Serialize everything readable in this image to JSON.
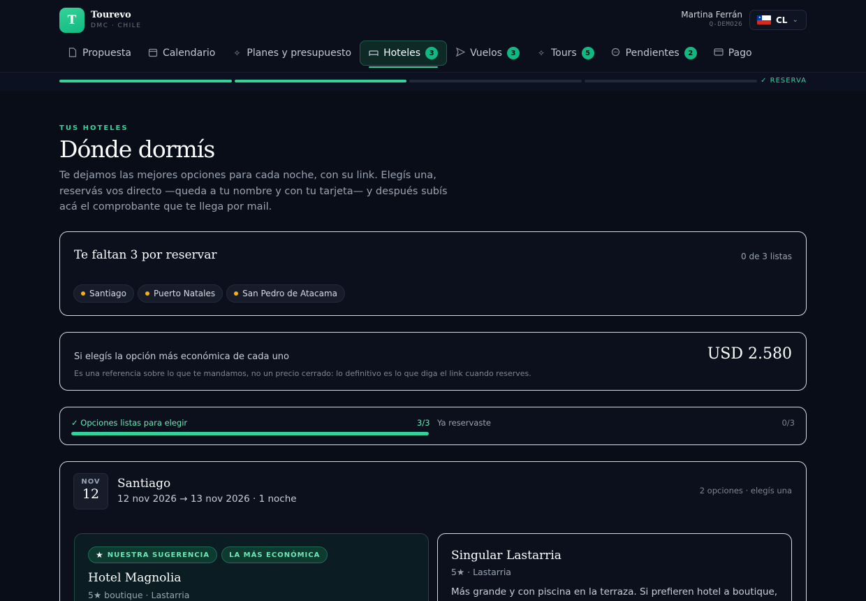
{
  "brand": {
    "name": "Tourevo",
    "subtitle": "DMC · CHILE",
    "logo_letter": "T"
  },
  "user": {
    "name": "Martina Ferrán",
    "code": "Q-DEMO26"
  },
  "country": {
    "code": "CL",
    "flag": "chile-flag-icon"
  },
  "nav": {
    "tabs": [
      {
        "label": "Propuesta",
        "icon": "document-icon",
        "badge": ""
      },
      {
        "label": "Calendario",
        "icon": "calendar-icon",
        "badge": ""
      },
      {
        "label": "Planes y presupuesto",
        "icon": "sparkle-icon",
        "badge": ""
      },
      {
        "label": "Hoteles",
        "icon": "bed-icon",
        "badge": "3",
        "active": true
      },
      {
        "label": "Vuelos",
        "icon": "plane-icon",
        "badge": "3"
      },
      {
        "label": "Tours",
        "icon": "sparkle-icon",
        "badge": "5"
      },
      {
        "label": "Pendientes",
        "icon": "chat-icon",
        "badge": "2"
      },
      {
        "label": "Pago",
        "icon": "card-icon",
        "badge": ""
      }
    ]
  },
  "progress": {
    "steps_done": 2,
    "steps_total": 4,
    "final_label": "✓ RESERVA"
  },
  "intro": {
    "eyebrow": "TUS HOTELES",
    "title": "Dónde dormís",
    "lede": "Te dejamos las mejores opciones para cada noche, con su link. Elegís una, reservás vos directo —queda a tu nombre y con tu tarjeta— y después subís acá el comprobante que te llega por mail."
  },
  "pending": {
    "heading": "Te faltan 3 por reservar",
    "count": "0 de 3 listas",
    "cities": [
      "Santiago",
      "Puerto Natales",
      "San Pedro de Atacama"
    ]
  },
  "estimate": {
    "label": "Si elegís la opción más económica de cada uno",
    "note": "Es una referencia sobre lo que te mandamos, no un precio cerrado: lo definitivo es lo que diga el link cuando reserves.",
    "price": "USD 2.580"
  },
  "status": {
    "ready_label": "✓ Opciones listas para elegir",
    "ready_count": "3/3",
    "ready_fraction": 1,
    "booked_label": "Ya reservaste",
    "booked_count": "0/3"
  },
  "stay": {
    "month": "NOV",
    "day": "12",
    "city": "Santiago",
    "dates": "12 nov 2026 → 13 nov 2026 · 1 noche",
    "options": "2 opciones · elegís una",
    "hotels": [
      {
        "tags": [
          "NUESTRA SUGERENCIA",
          "LA MÁS ECONÓMICA"
        ],
        "name": "Hotel Magnolia",
        "meta": "5★ boutique · Lastarria",
        "description": ""
      },
      {
        "tags": [],
        "name": "Singular Lastarria",
        "meta": "5★ · Lastarria",
        "description": "Más grande y con piscina en la terraza. Si prefieren hotel a boutique, es"
      }
    ]
  }
}
